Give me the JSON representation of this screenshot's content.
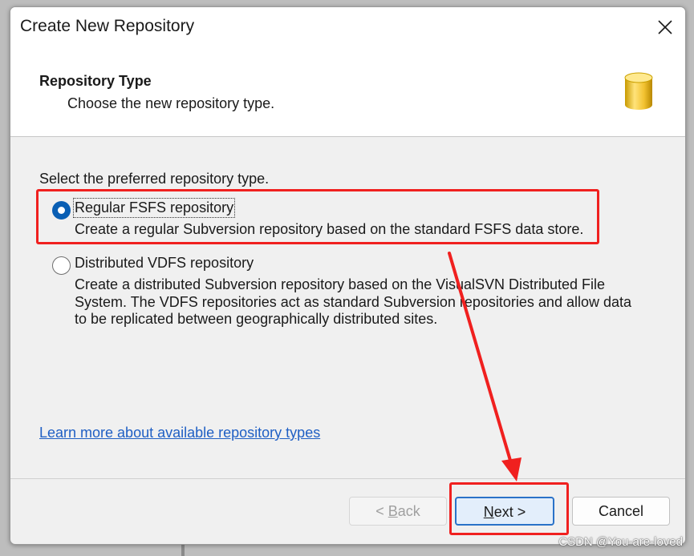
{
  "window": {
    "title": "Create New Repository"
  },
  "header": {
    "title": "Repository Type",
    "subtitle": "Choose the new repository type.",
    "icon": "database-icon"
  },
  "body": {
    "prompt": "Select the preferred repository type.",
    "options": [
      {
        "label": "Regular FSFS repository",
        "description": "Create a regular Subversion repository based on the standard FSFS data store.",
        "selected": true
      },
      {
        "label": "Distributed VDFS repository",
        "description": "Create a distributed Subversion repository based on the VisualSVN Distributed File System. The VDFS repositories act as standard Subversion repositories and allow data to be replicated between geographically distributed sites.",
        "selected": false
      }
    ],
    "learn_more_link": "Learn more about available repository types"
  },
  "buttons": {
    "back_prefix": "< ",
    "back_mnemonic": "B",
    "back_rest": "ack",
    "next_mnemonic": "N",
    "next_rest": "ext >",
    "cancel": "Cancel"
  },
  "watermark": "CSDN @You-are-loved",
  "colors": {
    "annotation_red": "#f0201f",
    "accent_blue": "#0a5fb4",
    "link_blue": "#1f5fc4"
  }
}
